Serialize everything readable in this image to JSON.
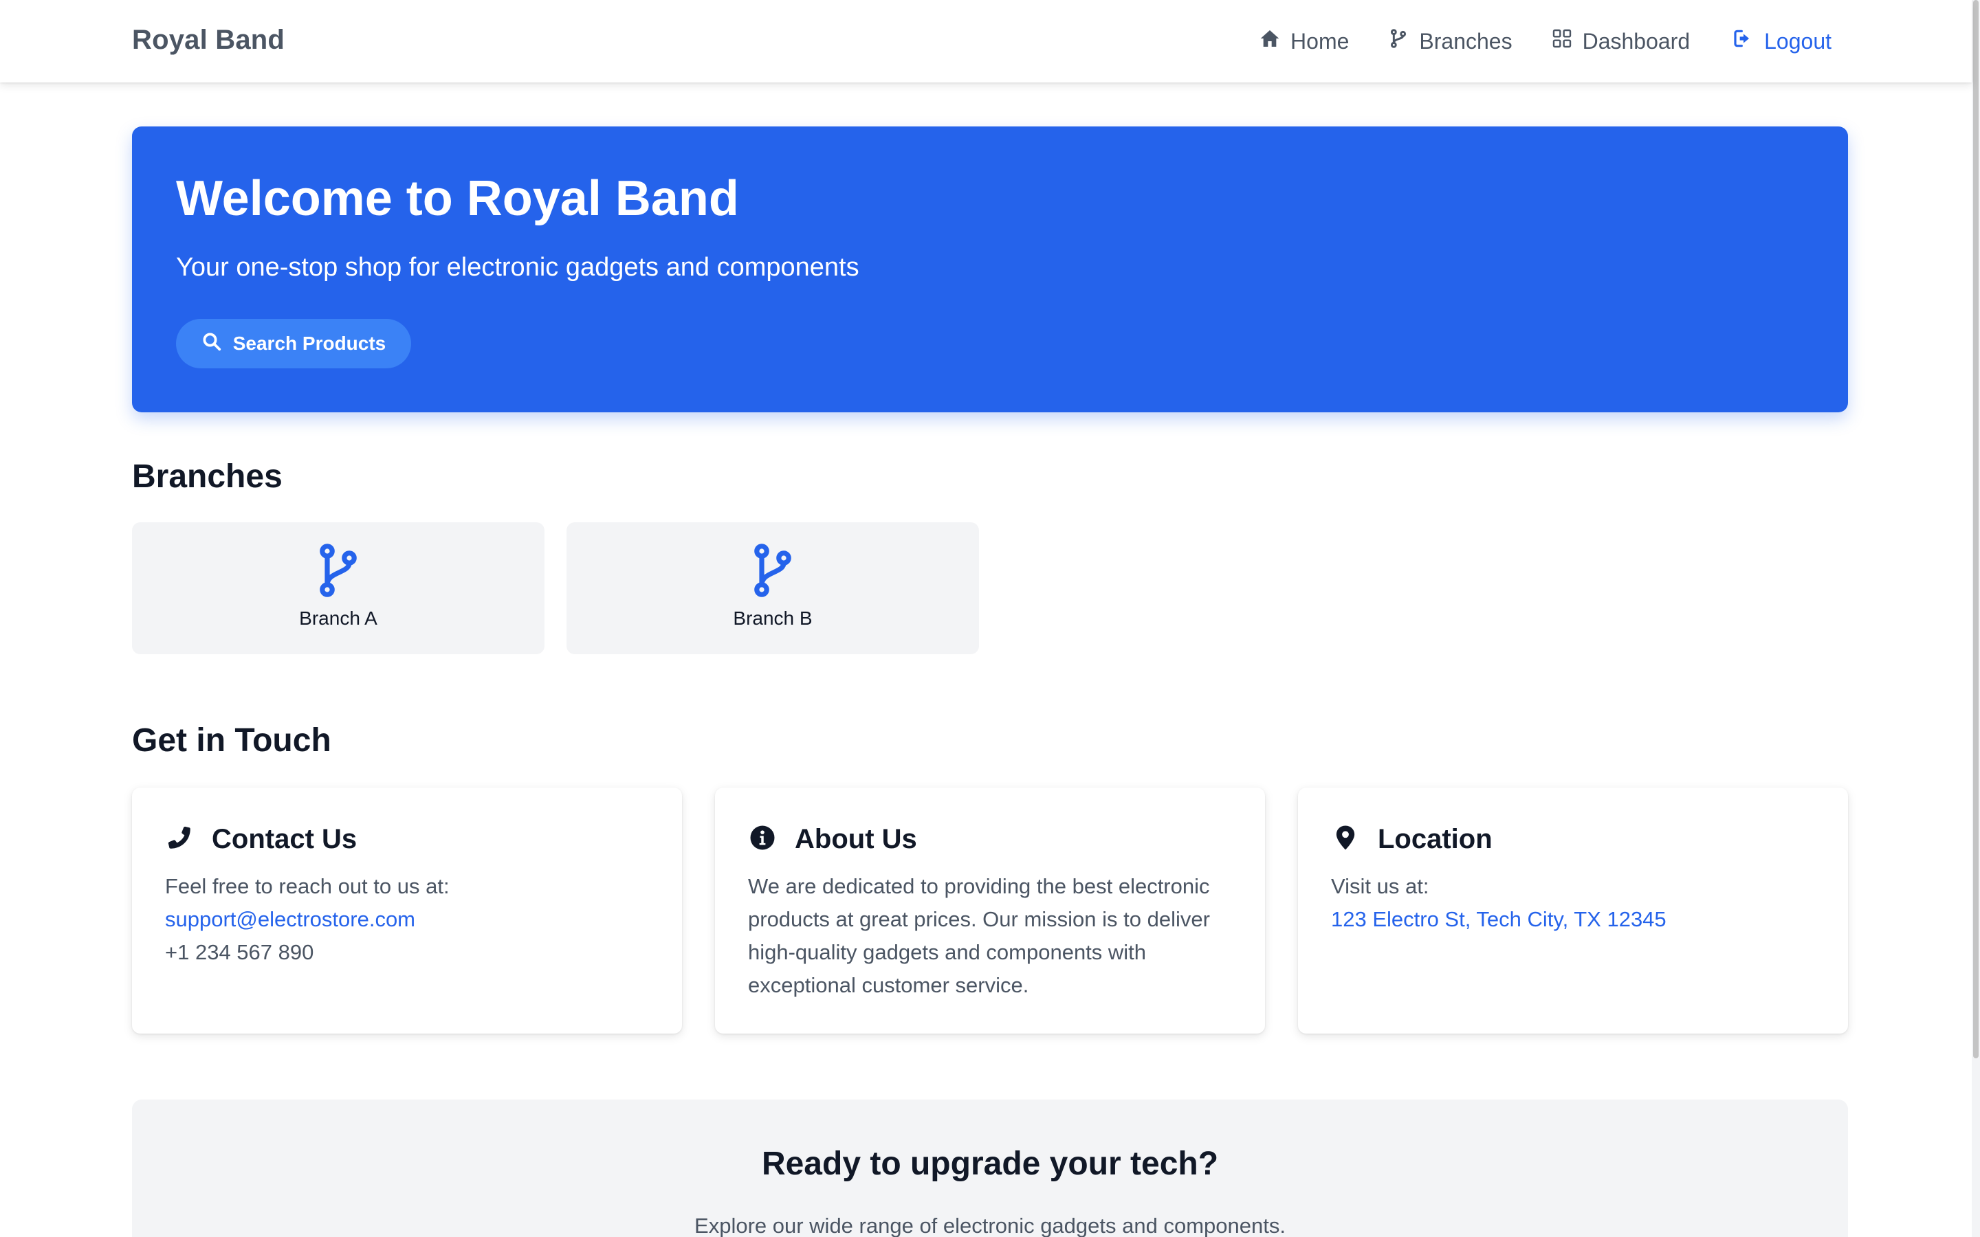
{
  "navbar": {
    "brand": "Royal Band",
    "links": [
      {
        "label": "Home",
        "icon": "home-icon"
      },
      {
        "label": "Branches",
        "icon": "branch-icon"
      },
      {
        "label": "Dashboard",
        "icon": "grid-icon"
      },
      {
        "label": "Logout",
        "icon": "logout-icon"
      }
    ]
  },
  "hero": {
    "title": "Welcome to Royal Band",
    "subtitle": "Your one-stop shop for electronic gadgets and components",
    "button_label": "Search Products",
    "button_icon": "search-icon"
  },
  "branches": {
    "heading": "Branches",
    "items": [
      {
        "label": "Branch A",
        "icon": "branch-icon"
      },
      {
        "label": "Branch B",
        "icon": "branch-icon"
      }
    ]
  },
  "contact": {
    "heading": "Get in Touch",
    "cards": [
      {
        "title": "Contact Us",
        "icon": "phone-icon",
        "text": "Feel free to reach out to us at:",
        "email": "support@electrostore.com",
        "phone": "+1 234 567 890"
      },
      {
        "title": "About Us",
        "icon": "info-icon",
        "text": "We are dedicated to providing the best electronic products at great prices. Our mission is to deliver high-quality gadgets and components with exceptional customer service."
      },
      {
        "title": "Location",
        "icon": "map-pin-icon",
        "text": "Visit us at:",
        "address": "123 Electro St, Tech City, TX 12345"
      }
    ]
  },
  "cta": {
    "title": "Ready to upgrade your tech?",
    "subtitle": "Explore our wide range of electronic gadgets and components."
  },
  "colors": {
    "primary": "#2563eb",
    "button": "#3b82f6",
    "text_muted": "#4b5563",
    "card_bg": "#f3f4f6"
  }
}
